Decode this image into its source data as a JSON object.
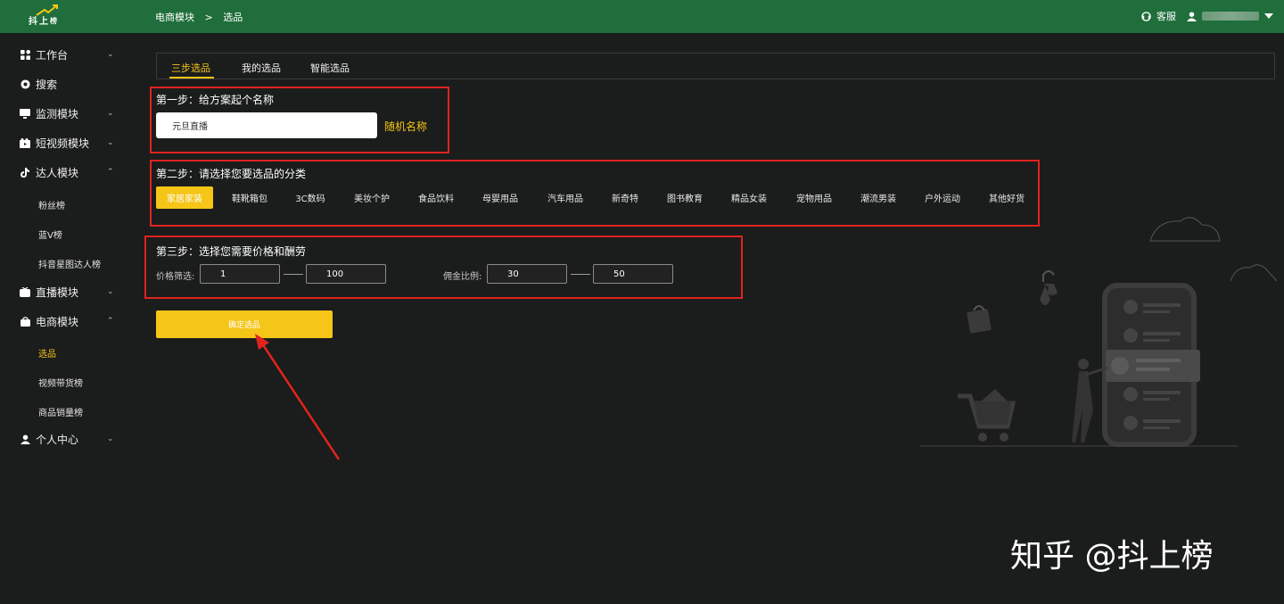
{
  "header": {
    "logo_text": [
      "抖",
      "上",
      "榜"
    ],
    "breadcrumb": [
      "电商模块",
      ">",
      "选品"
    ],
    "service_label": "客服"
  },
  "sidebar": {
    "items": [
      {
        "label": "工作台",
        "icon": "grid-icon"
      },
      {
        "label": "搜索",
        "icon": "search-icon"
      },
      {
        "label": "监测模块",
        "icon": "monitor-icon"
      },
      {
        "label": "短视频模块",
        "icon": "video-icon"
      },
      {
        "label": "达人模块",
        "icon": "tiktok-icon"
      },
      {
        "label": "直播模块",
        "icon": "live-icon"
      },
      {
        "label": "电商模块",
        "icon": "bag-icon"
      },
      {
        "label": "个人中心",
        "icon": "user-icon"
      }
    ],
    "talent_sub": [
      "粉丝榜",
      "蓝V榜",
      "抖音星图达人榜"
    ],
    "ecommerce_sub": [
      "选品",
      "视频带货榜",
      "商品销量榜"
    ]
  },
  "tabs": [
    "三步选品",
    "我的选品",
    "智能选品"
  ],
  "step1": {
    "title": "第一步：给方案起个名称",
    "input_value": "元旦直播",
    "random_label": "随机名称"
  },
  "step2": {
    "title": "第二步：请选择您要选品的分类",
    "categories": [
      "家居家装",
      "鞋靴箱包",
      "3C数码",
      "美妆个护",
      "食品饮料",
      "母婴用品",
      "汽车用品",
      "新奇特",
      "图书教育",
      "精品女装",
      "宠物用品",
      "潮流男装",
      "户外运动",
      "其他好货"
    ]
  },
  "step3": {
    "title": "第三步：选择您需要价格和酬劳",
    "price_label": "价格筛选:",
    "price_min": "1",
    "price_max": "100",
    "commission_label": "佣金比例:",
    "commission_min": "30",
    "commission_max": "50"
  },
  "confirm_label": "确定选品",
  "watermark": "知乎 @抖上榜",
  "colors": {
    "topbar": "#1f6e3b",
    "accent": "#f5c518",
    "highlight_box": "#e0231f",
    "background": "#1b1c1c"
  }
}
